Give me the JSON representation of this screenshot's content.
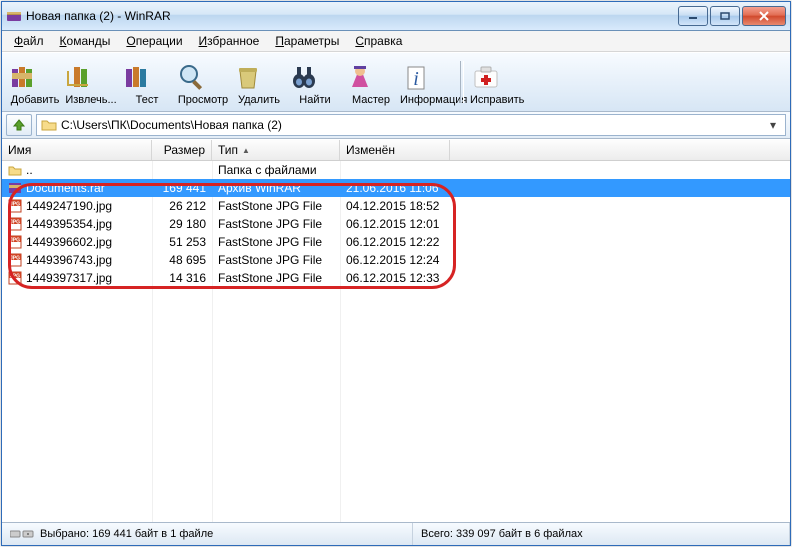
{
  "window": {
    "title": "Новая папка (2) - WinRAR"
  },
  "menus": [
    {
      "label": "Файл",
      "u": 0
    },
    {
      "label": "Команды",
      "u": 0
    },
    {
      "label": "Операции",
      "u": 0
    },
    {
      "label": "Избранное",
      "u": 0
    },
    {
      "label": "Параметры",
      "u": 0
    },
    {
      "label": "Справка",
      "u": 0
    }
  ],
  "toolbar": [
    {
      "name": "add",
      "label": "Добавить",
      "icon": "books-add"
    },
    {
      "name": "extract",
      "label": "Извлечь...",
      "icon": "books-extract"
    },
    {
      "name": "test",
      "label": "Тест",
      "icon": "books-test"
    },
    {
      "name": "view",
      "label": "Просмотр",
      "icon": "magnifier"
    },
    {
      "name": "delete",
      "label": "Удалить",
      "icon": "trash"
    },
    {
      "name": "find",
      "label": "Найти",
      "icon": "binoculars"
    },
    {
      "name": "wizard",
      "label": "Мастер",
      "icon": "wizard"
    },
    {
      "name": "info",
      "label": "Информация",
      "icon": "info-i"
    },
    {
      "sep": true
    },
    {
      "name": "repair",
      "label": "Исправить",
      "icon": "first-aid"
    }
  ],
  "path": "C:\\Users\\ПК\\Documents\\Новая папка (2)",
  "columns": {
    "name": "Имя",
    "size": "Размер",
    "type": "Тип",
    "modified": "Изменён"
  },
  "parent_row": {
    "name": "..",
    "type": "Папка с файлами"
  },
  "rows": [
    {
      "name": "Documents.rar",
      "size": "169 441",
      "type": "Архив WinRAR",
      "modified": "21.06.2016 11:06",
      "icon": "rar",
      "selected": true
    },
    {
      "name": "1449247190.jpg",
      "size": "26 212",
      "type": "FastStone JPG File",
      "modified": "04.12.2015 18:52",
      "icon": "jpg"
    },
    {
      "name": "1449395354.jpg",
      "size": "29 180",
      "type": "FastStone JPG File",
      "modified": "06.12.2015 12:01",
      "icon": "jpg"
    },
    {
      "name": "1449396602.jpg",
      "size": "51 253",
      "type": "FastStone JPG File",
      "modified": "06.12.2015 12:22",
      "icon": "jpg"
    },
    {
      "name": "1449396743.jpg",
      "size": "48 695",
      "type": "FastStone JPG File",
      "modified": "06.12.2015 12:24",
      "icon": "jpg"
    },
    {
      "name": "1449397317.jpg",
      "size": "14 316",
      "type": "FastStone JPG File",
      "modified": "06.12.2015 12:33",
      "icon": "jpg"
    }
  ],
  "status": {
    "selected": "Выбрано: 169 441 байт в 1 файле",
    "total": "Всего: 339 097 байт в 6 файлах"
  }
}
